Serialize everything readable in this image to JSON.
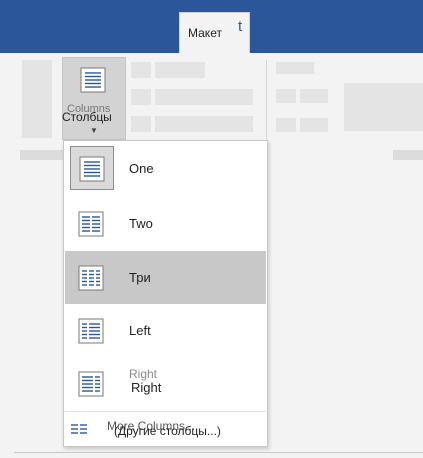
{
  "ribbon": {
    "active_tab_label": "Макет",
    "active_tab_glyph": "t",
    "accent_color": "#2b579a"
  },
  "columns_button": {
    "label": "Столбцы",
    "ghost_label": "Columns",
    "icon": "columns-icon"
  },
  "columns_menu": {
    "items": [
      {
        "label": "One",
        "ghost_label": "",
        "icon": "one-column-icon"
      },
      {
        "label": "Two",
        "ghost_label": "",
        "icon": "two-columns-icon"
      },
      {
        "label": "Три",
        "ghost_label": "",
        "icon": "three-columns-icon"
      },
      {
        "label": "Left",
        "ghost_label": "",
        "icon": "left-column-icon"
      },
      {
        "label": "Right",
        "ghost_label": "Right",
        "icon": "right-column-icon"
      }
    ],
    "selected_index": 0,
    "highlighted_index": 2,
    "more": {
      "label": "(Другие столбцы...)",
      "ghost_label": "More Columns...",
      "icon": "more-columns-icon"
    }
  }
}
